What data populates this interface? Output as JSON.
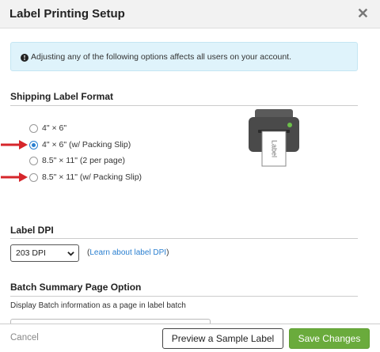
{
  "dialog": {
    "title": "Label Printing Setup",
    "close_glyph": "✕"
  },
  "notice": {
    "icon": "info-icon",
    "icon_glyph": "!",
    "text": "Adjusting any of the following options affects all users on your account."
  },
  "shipping_label_format": {
    "heading": "Shipping Label Format",
    "options": [
      {
        "label": "4\" × 6\"",
        "checked": false
      },
      {
        "label": "4\" × 6\" (w/ Packing Slip)",
        "checked": true
      },
      {
        "label": "8.5\" × 11\" (2 per page)",
        "checked": false
      },
      {
        "label": "8.5\" × 11\" (w/ Packing Slip)",
        "checked": false
      }
    ],
    "printer_label_text": "Label"
  },
  "label_dpi": {
    "heading": "Label DPI",
    "selected": "203 DPI",
    "learn_open": "(",
    "learn_link": "Learn about label DPI",
    "learn_close": ")"
  },
  "batch_summary": {
    "heading": "Batch Summary Page Option",
    "description": "Display Batch information as a page in label batch"
  },
  "footer": {
    "cancel": "Cancel",
    "preview": "Preview a Sample Label",
    "save": "Save Changes"
  },
  "colors": {
    "accent": "#2a7fd0",
    "save_button": "#6aab3c",
    "notice_bg": "#dff3fb",
    "arrow": "#d6262b",
    "printer_light": "#6cc04a"
  }
}
